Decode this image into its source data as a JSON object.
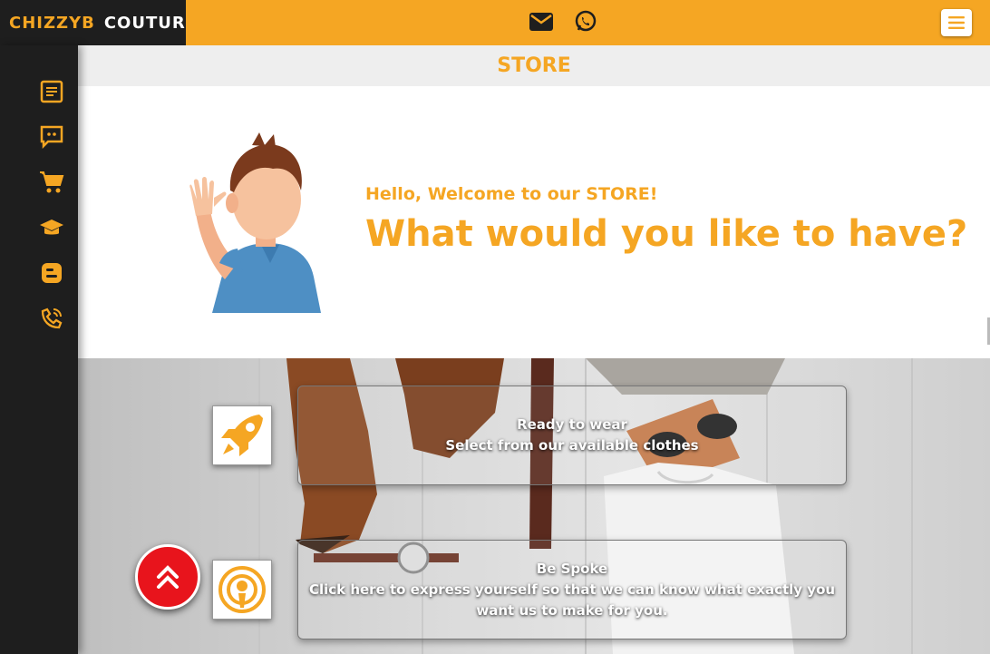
{
  "header": {
    "logo_part1": "CHIZZYB",
    "logo_part2": "COUTURE",
    "icons": [
      "mail-icon",
      "whatsapp-icon"
    ],
    "menu_icon": "hamburger-icon"
  },
  "sidebar": {
    "items": [
      {
        "icon": "article-icon"
      },
      {
        "icon": "chat-icon"
      },
      {
        "icon": "cart-icon"
      },
      {
        "icon": "graduation-cap-icon"
      },
      {
        "icon": "blogger-icon"
      },
      {
        "icon": "phone-icon"
      }
    ]
  },
  "page": {
    "title": "STORE"
  },
  "welcome": {
    "hello": "Hello, Welcome to our STORE!",
    "question": "What would you like to have?"
  },
  "cards": [
    {
      "icon": "rocket-icon",
      "line1": "Ready to wear",
      "line2": "Select from our available clothes"
    },
    {
      "icon": "podcast-icon",
      "line1": "Be Spoke",
      "line2": "Click here to express yourself so that we can know what exactly you want us to make for you."
    }
  ],
  "back_to_top_icon": "chevrons-up-icon",
  "colors": {
    "accent": "#f5a623",
    "dark": "#1e1e1e",
    "back_to_top": "#e8141c"
  }
}
